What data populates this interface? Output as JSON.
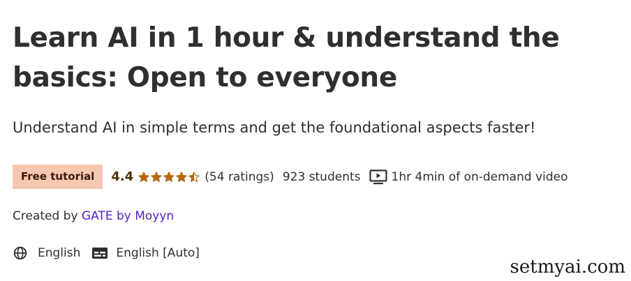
{
  "course": {
    "title": "Learn AI in 1 hour & understand the basics: Open to everyone",
    "subtitle": "Understand AI in simple terms and get the foundational aspects faster!",
    "badge": "Free tutorial",
    "rating_value": "4.4",
    "rating_stars": 4.4,
    "ratings_count": "(54 ratings)",
    "students": "923 students",
    "video_length": "1hr 4min of on-demand video",
    "created_by_prefix": "Created by",
    "instructor_name": "GATE by Moyyn",
    "language": "English",
    "captions": "English [Auto]"
  },
  "watermark": "setmyai.com",
  "icons": {
    "star": "star-icon",
    "video": "video-icon",
    "globe": "globe-icon",
    "captions": "closed-captions-icon"
  },
  "colors": {
    "text": "#2d2f31",
    "badge_bg": "#f6c7b1",
    "rating_text": "#4d3105",
    "star": "#b4690e",
    "link": "#5022c3"
  }
}
